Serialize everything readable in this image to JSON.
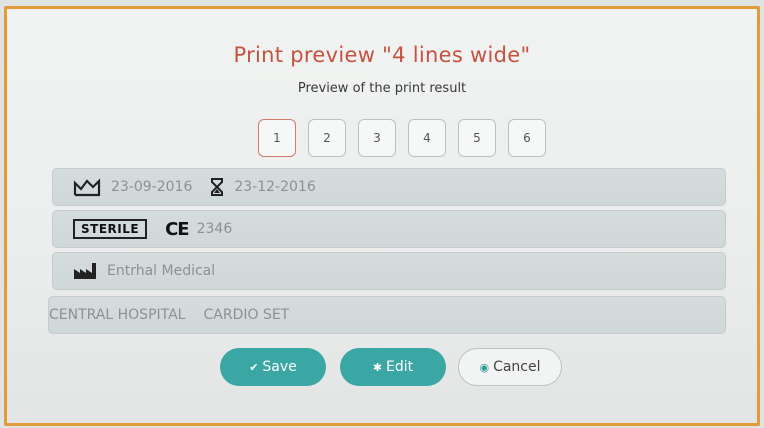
{
  "dialog": {
    "title": "Print preview \"4 lines wide\"",
    "subtitle": "Preview of the print result"
  },
  "pages": [
    "1",
    "2",
    "3",
    "4",
    "5",
    "6"
  ],
  "active_page": "1",
  "lines": {
    "line1": {
      "manufacture_date": "23-09-2016",
      "expiry_date": "23-12-2016"
    },
    "line2": {
      "sterile_label": "STERILE",
      "ce_mark": "CE",
      "ce_number": "2346"
    },
    "line3": {
      "manufacturer": "Entrhal Medical"
    },
    "line4": {
      "field1": "CENTRAL HOSPITAL",
      "field2": "CARDIO SET"
    }
  },
  "buttons": {
    "save": "Save",
    "edit": "Edit",
    "cancel": "Cancel"
  },
  "colors": {
    "title": "#c4523f",
    "accent": "#3aa7a5",
    "frame": "#e39a3a"
  }
}
